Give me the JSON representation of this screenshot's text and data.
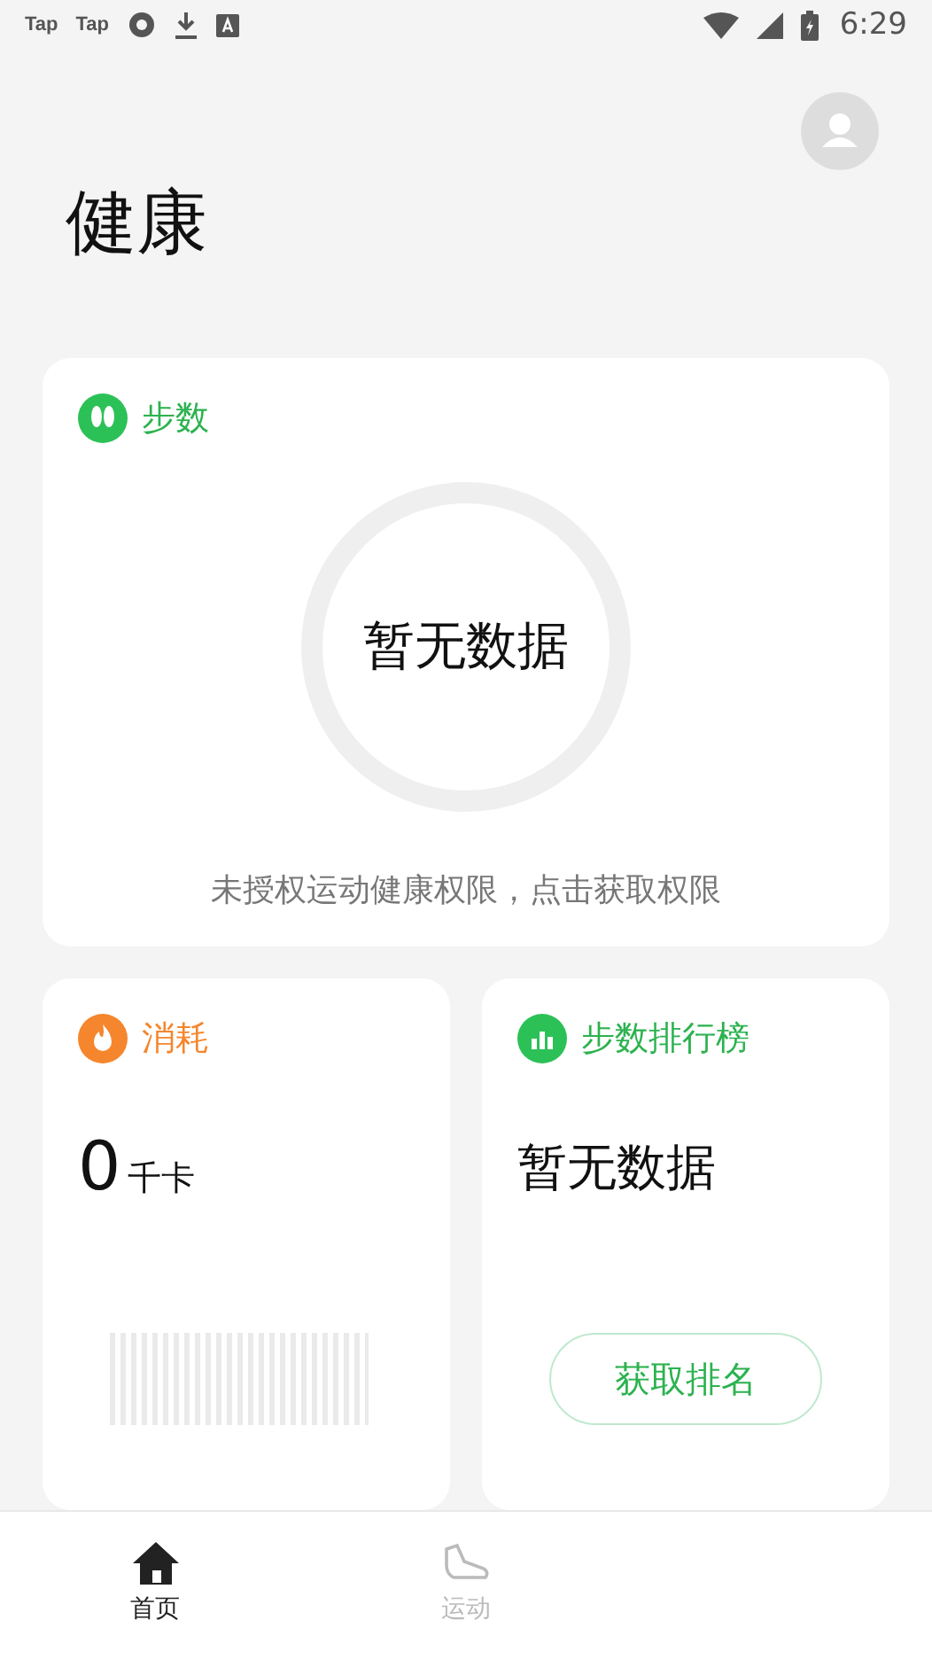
{
  "status_bar": {
    "app_labels": [
      "Tap",
      "Tap"
    ],
    "time": "6:29"
  },
  "title": "健康",
  "steps": {
    "title": "步数",
    "ring_text": "暂无数据",
    "hint": "未授权运动健康权限，点击获取权限"
  },
  "calories": {
    "title": "消耗",
    "value": "0",
    "unit": "千卡"
  },
  "ranking": {
    "title": "步数排行榜",
    "value": "暂无数据",
    "button": "获取排名"
  },
  "tabs": [
    {
      "label": "首页",
      "kind": "home",
      "selected": true
    },
    {
      "label": "运动",
      "kind": "shoe",
      "selected": false
    }
  ]
}
